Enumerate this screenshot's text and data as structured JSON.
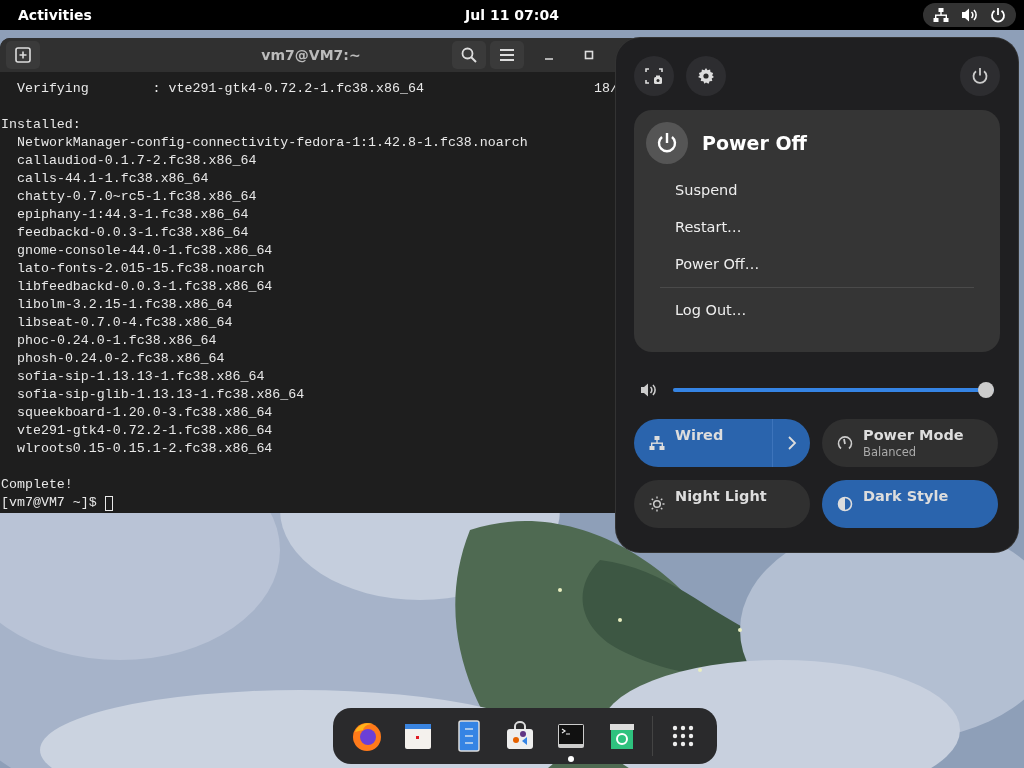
{
  "top_bar": {
    "activities": "Activities",
    "clock": "Jul 11  07:04"
  },
  "terminal": {
    "title": "vm7@VM7:~",
    "verify_line": {
      "text": "  Verifying        : vte291-gtk4-0.72.2-1.fc38.x86_64",
      "right": "18/"
    },
    "installed_heading": "Installed:",
    "packages": [
      "NetworkManager-config-connectivity-fedora-1:1.42.8-1.fc38.noarch",
      "callaudiod-0.1.7-2.fc38.x86_64",
      "calls-44.1-1.fc38.x86_64",
      "chatty-0.7.0~rc5-1.fc38.x86_64",
      "epiphany-1:44.3-1.fc38.x86_64",
      "feedbackd-0.0.3-1.fc38.x86_64",
      "gnome-console-44.0-1.fc38.x86_64",
      "lato-fonts-2.015-15.fc38.noarch",
      "libfeedbackd-0.0.3-1.fc38.x86_64",
      "libolm-3.2.15-1.fc38.x86_64",
      "libseat-0.7.0-4.fc38.x86_64",
      "phoc-0.24.0-1.fc38.x86_64",
      "phosh-0.24.0-2.fc38.x86_64",
      "sofia-sip-1.13.13-1.fc38.x86_64",
      "sofia-sip-glib-1.13.13-1.fc38.x86_64",
      "squeekboard-1.20.0-3.fc38.x86_64",
      "vte291-gtk4-0.72.2-1.fc38.x86_64",
      "wlroots0.15-0.15.1-2.fc38.x86_64"
    ],
    "complete": "Complete!",
    "prompt": "[vm7@VM7 ~]$ "
  },
  "quick_settings": {
    "power_menu": {
      "title": "Power Off",
      "items": [
        "Suspend",
        "Restart…",
        "Power Off…"
      ],
      "footer_items": [
        "Log Out…"
      ]
    },
    "volume": {
      "level": 1
    },
    "toggles": [
      {
        "kind": "split",
        "label": "Wired",
        "on": true
      },
      {
        "kind": "plain",
        "label": "Power Mode",
        "subtitle": "Balanced",
        "on": false
      },
      {
        "kind": "plain",
        "label": "Night Light",
        "on": false
      },
      {
        "kind": "plain",
        "label": "Dark Style",
        "on": true
      }
    ]
  },
  "dock": [
    {
      "kind": "browser",
      "running": false
    },
    {
      "kind": "calendar",
      "running": false
    },
    {
      "kind": "document",
      "running": false
    },
    {
      "kind": "store",
      "running": false
    },
    {
      "kind": "terminal",
      "running": true
    },
    {
      "kind": "trash",
      "running": false
    },
    {
      "kind": "grid",
      "running": false
    }
  ]
}
